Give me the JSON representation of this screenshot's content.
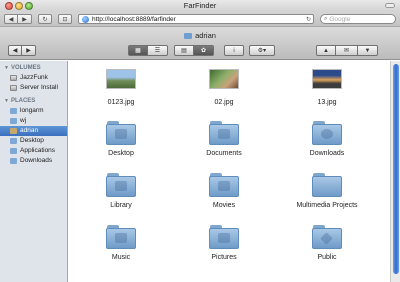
{
  "window": {
    "title": "FarFinder"
  },
  "browser": {
    "url": "http://localhost:8889/farfinder",
    "search_placeholder": "Google",
    "back_glyph": "◀",
    "forward_glyph": "▶",
    "reload_glyph": "↻",
    "bookmark_glyph": "⊡"
  },
  "toolbar": {
    "folder_name": "adrian",
    "back": "◀",
    "forward": "▶",
    "icon_view": "▦",
    "list_view": "☰",
    "quicklook": "▤",
    "gear_small": "✿",
    "info": "i",
    "action": "⚙▾",
    "upload": "▲",
    "mail": "✉",
    "download": "▼"
  },
  "sidebar": {
    "volumes_header": "VOLUMES",
    "volumes": [
      {
        "label": "JazzFunk",
        "icon": "drive-icon"
      },
      {
        "label": "Server Install",
        "icon": "drive-icon"
      }
    ],
    "places_header": "PLACES",
    "places": [
      {
        "label": "longarm",
        "icon": "folder-icon"
      },
      {
        "label": "wj",
        "icon": "folder-icon"
      },
      {
        "label": "adrian",
        "icon": "home-icon",
        "selected": true
      },
      {
        "label": "Desktop",
        "icon": "folder-icon"
      },
      {
        "label": "Applications",
        "icon": "folder-icon"
      },
      {
        "label": "Downloads",
        "icon": "folder-icon"
      }
    ]
  },
  "files": [
    {
      "name": "0123.jpg",
      "kind": "image"
    },
    {
      "name": "02.jpg",
      "kind": "image"
    },
    {
      "name": "13.jpg",
      "kind": "image"
    },
    {
      "name": "Desktop",
      "kind": "folder"
    },
    {
      "name": "Documents",
      "kind": "folder"
    },
    {
      "name": "Downloads",
      "kind": "folder"
    },
    {
      "name": "Library",
      "kind": "folder"
    },
    {
      "name": "Movies",
      "kind": "folder"
    },
    {
      "name": "Multimedia Projects",
      "kind": "folder"
    },
    {
      "name": "Music",
      "kind": "folder"
    },
    {
      "name": "Pictures",
      "kind": "folder"
    },
    {
      "name": "Public",
      "kind": "folder"
    }
  ],
  "colors": {
    "selection": "#3a70bd",
    "sidebar_bg": "#dee4ea",
    "folder_blue": "#8fb5db",
    "scroll_blue": "#2f6bd0"
  }
}
